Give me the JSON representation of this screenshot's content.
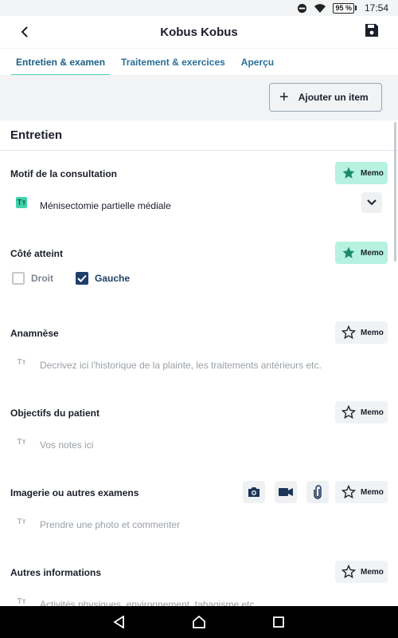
{
  "status": {
    "battery": "95 %",
    "time": "17:54"
  },
  "header": {
    "title": "Kobus Kobus"
  },
  "tabs": [
    {
      "label": "Entretien & examen",
      "active": true
    },
    {
      "label": "Traitement & exercices",
      "active": false
    },
    {
      "label": "Aperçu",
      "active": false
    }
  ],
  "toolbar": {
    "add_label": "Ajouter un item"
  },
  "section": {
    "title": "Entretien"
  },
  "fields": {
    "motif": {
      "label": "Motif de la consultation",
      "memo": "Memo",
      "memo_active": true,
      "value": "Ménisectomie partielle médiale"
    },
    "cote": {
      "label": "Côté atteint",
      "memo": "Memo",
      "memo_active": true,
      "options": [
        {
          "label": "Droit",
          "checked": false
        },
        {
          "label": "Gauche",
          "checked": true
        }
      ]
    },
    "anamnese": {
      "label": "Anamnèse",
      "memo": "Memo",
      "memo_active": false,
      "placeholder": "Decrivez ici l'historique de la plainte, les traitements antérieurs etc."
    },
    "objectifs": {
      "label": "Objectifs du patient",
      "memo": "Memo",
      "memo_active": false,
      "placeholder": "Vos notes ici"
    },
    "imagerie": {
      "label": "Imagerie ou autres examens",
      "memo": "Memo",
      "memo_active": false,
      "placeholder": "Prendre une photo et commenter"
    },
    "autres": {
      "label": "Autres informations",
      "memo": "Memo",
      "memo_active": false,
      "placeholder": "Activités physiques, environnement, tabagisme etc."
    }
  },
  "icons": {
    "text_format": "Tт",
    "accent": "#3fd3aa",
    "memo_active_bg": "#b6f2df",
    "link_color": "#2a6f99"
  }
}
